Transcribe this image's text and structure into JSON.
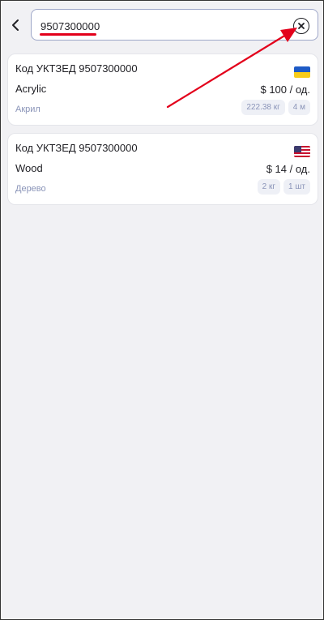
{
  "search": {
    "value": "9507300000"
  },
  "results": [
    {
      "code": "Код УКТЗЕД 9507300000",
      "flag": "ukraine-flag",
      "name": "Acrylic",
      "price": "$ 100 / од.",
      "subtitle": "Акрил",
      "tags": [
        "222.38 кг",
        "4 м"
      ]
    },
    {
      "code": "Код УКТЗЕД 9507300000",
      "flag": "usa-flag",
      "name": "Wood",
      "price": "$ 14 / од.",
      "subtitle": "Дерево",
      "tags": [
        "2 кг",
        "1 шт"
      ]
    }
  ],
  "annotation_color": "#e3001b"
}
